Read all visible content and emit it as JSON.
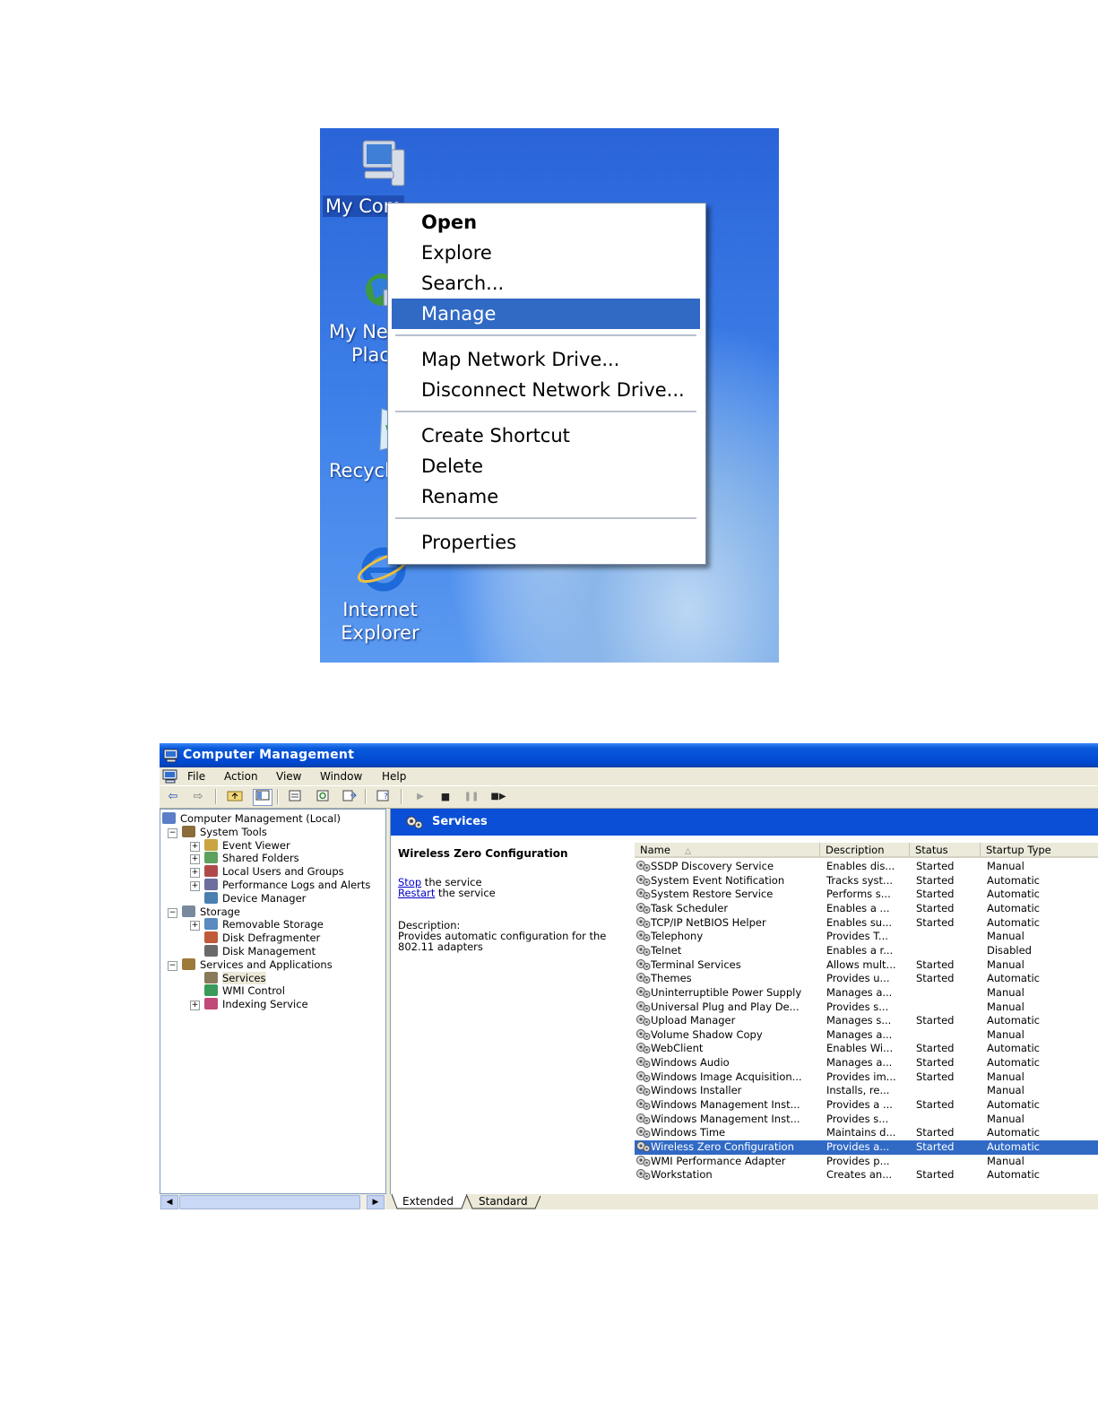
{
  "desktop": {
    "icons": [
      {
        "label_lines": [
          "My Com"
        ],
        "glyph": "computer-icon"
      },
      {
        "label_lines": [
          "My Net",
          "Plac"
        ],
        "glyph": "network-places-icon"
      },
      {
        "label_lines": [
          "Recycl"
        ],
        "glyph": "recycle-bin-icon"
      },
      {
        "label_lines": [
          "Internet",
          "Explorer"
        ],
        "glyph": "internet-explorer-icon"
      }
    ],
    "context_menu": {
      "items": [
        "Open",
        "Explore",
        "Search...",
        "Manage",
        "Map Network Drive...",
        "Disconnect Network Drive...",
        "Create Shortcut",
        "Delete",
        "Rename",
        "Properties"
      ],
      "highlighted": "Manage",
      "default_item": "Open"
    }
  },
  "window": {
    "title": "Computer Management",
    "menu": [
      "File",
      "Action",
      "View",
      "Window",
      "Help"
    ],
    "tree": [
      {
        "label": "Computer Management (Local)",
        "level": 0
      },
      {
        "label": "System Tools",
        "level": 1,
        "expander": "-"
      },
      {
        "label": "Event Viewer",
        "level": 2,
        "expander": "+"
      },
      {
        "label": "Shared Folders",
        "level": 2,
        "expander": "+"
      },
      {
        "label": "Local Users and Groups",
        "level": 2,
        "expander": "+"
      },
      {
        "label": "Performance Logs and Alerts",
        "level": 2,
        "expander": "+"
      },
      {
        "label": "Device Manager",
        "level": 2
      },
      {
        "label": "Storage",
        "level": 1,
        "expander": "-"
      },
      {
        "label": "Removable Storage",
        "level": 2,
        "expander": "+"
      },
      {
        "label": "Disk Defragmenter",
        "level": 2
      },
      {
        "label": "Disk Management",
        "level": 2
      },
      {
        "label": "Services and Applications",
        "level": 1,
        "expander": "-"
      },
      {
        "label": "Services",
        "level": 2,
        "selected": true
      },
      {
        "label": "WMI Control",
        "level": 2
      },
      {
        "label": "Indexing Service",
        "level": 2,
        "expander": "+"
      }
    ],
    "pane_title": "Services",
    "extended": {
      "service_name": "Wireless Zero Configuration",
      "stop_link": "Stop",
      "stop_rest": " the service",
      "restart_link": "Restart",
      "restart_rest": " the service",
      "description_label": "Description:",
      "description_text": "Provides automatic configuration for the 802.11 adapters"
    },
    "columns": [
      "Name",
      "Description",
      "Status",
      "Startup Type"
    ],
    "services": [
      [
        "SSDP Discovery Service",
        "Enables dis...",
        "Started",
        "Manual"
      ],
      [
        "System Event Notification",
        "Tracks syst...",
        "Started",
        "Automatic"
      ],
      [
        "System Restore Service",
        "Performs s...",
        "Started",
        "Automatic"
      ],
      [
        "Task Scheduler",
        "Enables a ...",
        "Started",
        "Automatic"
      ],
      [
        "TCP/IP NetBIOS Helper",
        "Enables su...",
        "Started",
        "Automatic"
      ],
      [
        "Telephony",
        "Provides T...",
        "",
        "Manual"
      ],
      [
        "Telnet",
        "Enables a r...",
        "",
        "Disabled"
      ],
      [
        "Terminal Services",
        "Allows mult...",
        "Started",
        "Manual"
      ],
      [
        "Themes",
        "Provides u...",
        "Started",
        "Automatic"
      ],
      [
        "Uninterruptible Power Supply",
        "Manages a...",
        "",
        "Manual"
      ],
      [
        "Universal Plug and Play De...",
        "Provides s...",
        "",
        "Manual"
      ],
      [
        "Upload Manager",
        "Manages s...",
        "Started",
        "Automatic"
      ],
      [
        "Volume Shadow Copy",
        "Manages a...",
        "",
        "Manual"
      ],
      [
        "WebClient",
        "Enables Wi...",
        "Started",
        "Automatic"
      ],
      [
        "Windows Audio",
        "Manages a...",
        "Started",
        "Automatic"
      ],
      [
        "Windows Image Acquisition...",
        "Provides im...",
        "Started",
        "Manual"
      ],
      [
        "Windows Installer",
        "Installs, re...",
        "",
        "Manual"
      ],
      [
        "Windows Management Inst...",
        "Provides a ...",
        "Started",
        "Automatic"
      ],
      [
        "Windows Management Inst...",
        "Provides s...",
        "",
        "Manual"
      ],
      [
        "Windows Time",
        "Maintains d...",
        "Started",
        "Automatic"
      ],
      [
        "Wireless Zero Configuration",
        "Provides a...",
        "Started",
        "Automatic"
      ],
      [
        "WMI Performance Adapter",
        "Provides p...",
        "",
        "Manual"
      ],
      [
        "Workstation",
        "Creates an...",
        "Started",
        "Automatic"
      ]
    ],
    "selected_service": "Wireless Zero Configuration",
    "bottom_tabs": [
      "Extended",
      "Standard"
    ],
    "active_tab": "Extended"
  }
}
